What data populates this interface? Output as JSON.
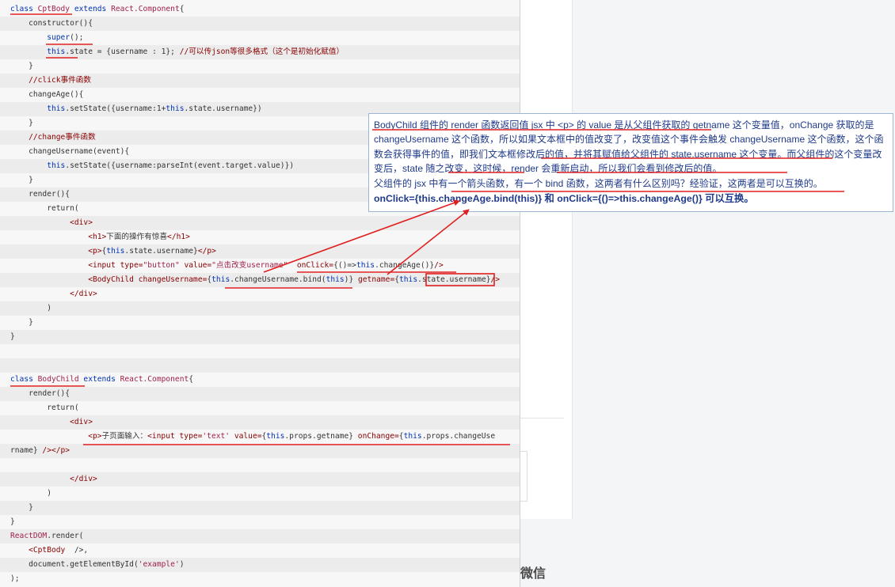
{
  "code_lines": [
    [
      {
        "t": "class ",
        "c": "kw"
      },
      {
        "t": "CptBody",
        "c": "cls"
      },
      {
        "t": " extends ",
        "c": "kw"
      },
      {
        "t": "React.Component",
        "c": "cls"
      },
      {
        "t": "{",
        "c": "txt"
      }
    ],
    [
      {
        "t": "    constructor(){",
        "c": "txt"
      }
    ],
    [
      {
        "t": "        ",
        "c": "txt"
      },
      {
        "t": "super",
        "c": "kw"
      },
      {
        "t": "();",
        "c": "txt"
      }
    ],
    [
      {
        "t": "        ",
        "c": "txt"
      },
      {
        "t": "this",
        "c": "kw"
      },
      {
        "t": ".state = {username : 1}; ",
        "c": "txt"
      },
      {
        "t": "//可以传json等很多格式（这个是初始化赋值）",
        "c": "cmt"
      }
    ],
    [
      {
        "t": "    }",
        "c": "txt"
      }
    ],
    [
      {
        "t": "    //click事件函数",
        "c": "cmt"
      }
    ],
    [
      {
        "t": "    changeAge(){",
        "c": "txt"
      }
    ],
    [
      {
        "t": "        ",
        "c": "txt"
      },
      {
        "t": "this",
        "c": "kw"
      },
      {
        "t": ".setState({username:1+",
        "c": "txt"
      },
      {
        "t": "this",
        "c": "kw"
      },
      {
        "t": ".state.username})",
        "c": "txt"
      }
    ],
    [
      {
        "t": "    }",
        "c": "txt"
      }
    ],
    [
      {
        "t": "    //change事件函数",
        "c": "cmt"
      }
    ],
    [
      {
        "t": "    changeUsername(event){",
        "c": "txt"
      }
    ],
    [
      {
        "t": "        ",
        "c": "txt"
      },
      {
        "t": "this",
        "c": "kw"
      },
      {
        "t": ".setState({username:parseInt(event.target.value)})",
        "c": "txt"
      }
    ],
    [
      {
        "t": "    }",
        "c": "txt"
      }
    ],
    [
      {
        "t": "    render(){",
        "c": "txt"
      }
    ],
    [
      {
        "t": "        return(",
        "c": "txt"
      }
    ],
    [
      {
        "t": "             <div>",
        "c": "tag"
      }
    ],
    [
      {
        "t": "                 <h1>",
        "c": "tag"
      },
      {
        "t": "下面的操作有惊喜",
        "c": "txt"
      },
      {
        "t": "</h1>",
        "c": "tag"
      }
    ],
    [
      {
        "t": "                 <p>",
        "c": "tag"
      },
      {
        "t": "{",
        "c": "txt"
      },
      {
        "t": "this",
        "c": "kw"
      },
      {
        "t": ".state.username}",
        "c": "txt"
      },
      {
        "t": "</p>",
        "c": "tag"
      }
    ],
    [
      {
        "t": "                 <input type=",
        "c": "tag"
      },
      {
        "t": "\"button\"",
        "c": "str"
      },
      {
        "t": " value=",
        "c": "tag"
      },
      {
        "t": "\"点击改变username\"",
        "c": "str"
      },
      {
        "t": "  onClick=",
        "c": "tag"
      },
      {
        "t": "{()=>",
        "c": "txt"
      },
      {
        "t": "this",
        "c": "kw"
      },
      {
        "t": ".changeAge()}",
        "c": "txt"
      },
      {
        "t": "/>",
        "c": "tag"
      }
    ],
    [
      {
        "t": "                 <BodyChild changeUsername=",
        "c": "tag"
      },
      {
        "t": "{",
        "c": "txt"
      },
      {
        "t": "this",
        "c": "kw"
      },
      {
        "t": ".changeUsername.bind(",
        "c": "txt"
      },
      {
        "t": "this",
        "c": "kw"
      },
      {
        "t": ")}",
        "c": "txt"
      },
      {
        "t": " getname=",
        "c": "tag"
      },
      {
        "t": "{",
        "c": "txt"
      },
      {
        "t": "this",
        "c": "kw"
      },
      {
        "t": ".state.username}",
        "c": "txt"
      },
      {
        "t": "/>",
        "c": "tag"
      }
    ],
    [
      {
        "t": "             </div>",
        "c": "tag"
      }
    ],
    [
      {
        "t": "        )",
        "c": "txt"
      }
    ],
    [
      {
        "t": "    }",
        "c": "txt"
      }
    ],
    [
      {
        "t": "}",
        "c": "txt"
      }
    ],
    [
      {
        "t": "",
        "c": "txt"
      }
    ],
    [
      {
        "t": "",
        "c": "txt"
      }
    ],
    [
      {
        "t": "class ",
        "c": "kw"
      },
      {
        "t": "BodyChild",
        "c": "cls"
      },
      {
        "t": " extends ",
        "c": "kw"
      },
      {
        "t": "React.Component",
        "c": "cls"
      },
      {
        "t": "{",
        "c": "txt"
      }
    ],
    [
      {
        "t": "    render(){",
        "c": "txt"
      }
    ],
    [
      {
        "t": "        return(",
        "c": "txt"
      }
    ],
    [
      {
        "t": "             <div>",
        "c": "tag"
      }
    ],
    [
      {
        "t": "                 <p>",
        "c": "tag"
      },
      {
        "t": "子页面输入：",
        "c": "txt"
      },
      {
        "t": "<input type=",
        "c": "tag"
      },
      {
        "t": "'text'",
        "c": "str"
      },
      {
        "t": " value=",
        "c": "tag"
      },
      {
        "t": "{",
        "c": "txt"
      },
      {
        "t": "this",
        "c": "kw"
      },
      {
        "t": ".props.getname}",
        "c": "txt"
      },
      {
        "t": " onChange=",
        "c": "tag"
      },
      {
        "t": "{",
        "c": "txt"
      },
      {
        "t": "this",
        "c": "kw"
      },
      {
        "t": ".props.changeUse",
        "c": "txt"
      }
    ],
    [
      {
        "t": "rname}",
        "c": "txt"
      },
      {
        "t": " /></p>",
        "c": "tag"
      }
    ],
    [
      {
        "t": "",
        "c": "txt"
      }
    ],
    [
      {
        "t": "             </div>",
        "c": "tag"
      }
    ],
    [
      {
        "t": "        )",
        "c": "txt"
      }
    ],
    [
      {
        "t": "    }",
        "c": "txt"
      }
    ],
    [
      {
        "t": "}",
        "c": "txt"
      }
    ],
    [
      {
        "t": "ReactDOM",
        "c": "cls"
      },
      {
        "t": ".render(",
        "c": "txt"
      }
    ],
    [
      {
        "t": "    ",
        "c": "txt"
      },
      {
        "t": "<CptBody",
        "c": "tag"
      },
      {
        "t": "  />,",
        "c": "txt"
      }
    ],
    [
      {
        "t": "    document.getElementById(",
        "c": "txt"
      },
      {
        "t": "'example'",
        "c": "str"
      },
      {
        "t": ")",
        "c": "txt"
      }
    ],
    [
      {
        "t": ");",
        "c": "txt"
      }
    ]
  ],
  "callout": {
    "paragraph1": "BodyChild 组件的 render 函数返回值 jsx 中 <p> 的 value 是从父组件获取的 getname 这个变量值，onChange 获取的是 changeUsername 这个函数，所以如果文本框中的值改变了，改变值这个事件会触发 changeUsername 这个函数，这个函数会获得事件的值，即我们文本框修改后的值，并将其赋值给父组件的 state.username 这个变量。而父组件的这个变量改变后，state 随之改变，这时候，render 会重新启动，所以我们会看到修改后的值。",
    "paragraph2": "父组件的 jsx 中有一个箭头函数，有一个 bind 函数，这两者有什么区别吗？经验证，这两者是可以互换的。",
    "paragraph3_bold": "onClick={this.changeAge.bind(this)} 和 onClick={()=>this.changeAge()} 可以互换。"
  },
  "right_side": {
    "partial_text": "微信"
  },
  "colors": {
    "annotation_red": "#e02020",
    "callout_text": "#1f3a8a",
    "code_background": "#f7f7f7"
  }
}
